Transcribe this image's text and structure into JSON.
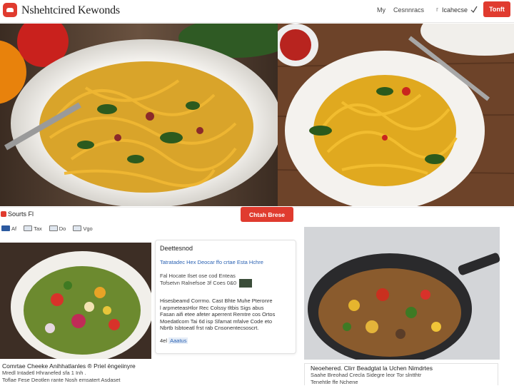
{
  "header": {
    "site_title": "Nshehtcired Kewonds",
    "nav_my": "My",
    "nav_link": "Cesnnracs",
    "nav_sep": "r",
    "nav_link2": "Icahecse",
    "signup_label": "Tonft"
  },
  "toolbar": {
    "results_label": "Sourts Fl",
    "search_button": "Chtah Brese",
    "filters": [
      {
        "label": "Af",
        "style": "blue"
      },
      {
        "label": "Tax",
        "style": "plain"
      },
      {
        "label": "Do",
        "style": "plain"
      },
      {
        "label": "Vgo",
        "style": "plain"
      }
    ]
  },
  "card1": {
    "caption_line1": "Comrtae Cheeke Anihhatlanles ® Priel ëngeiinyre",
    "caption_line2": "Mredl Intadetl Hhranefed sfa 1 Inh .",
    "caption_line3": "Toflae Fese Deotlen rante Nosh emsatert Asdaset"
  },
  "detail": {
    "title": "Deettesnod",
    "link_line": "Tatratadec Hex Deocar ffo crtae Esta Hchre",
    "meta_line1": "Fal Hocate Ilset ose cod Enteas",
    "meta_line2": "Tofsetvn Ralnefsoe 3f Coes 0&0",
    "text_line1": "Hisesbeamd Corrmo. Cast Bhte Muhe Pteronre",
    "text_line2": "l arpmeteasHlor Rec Colssy tltbis Sigs abus",
    "text_line3": "Fasan aifi etee afeter aperrent Remtre cos Ortos",
    "text_line4": "Moedatlcom Tai 6d isp Sfamat mfalve Code eto",
    "text_line5": "Nbrtb Isbtoeatl frst rab Cnsonentecsoscrt.",
    "foot_text": "4el",
    "foot_tag": "Aaatus"
  },
  "card3": {
    "caption_line1": "Neoehered. Clirr Beadgtat la Uchen Nimdrtes",
    "caption_line2": "Saahe Breohad Crecla Sidegre leor Tor slntthtr",
    "caption_line3": "Tenehtle ffe Nchene"
  },
  "colors": {
    "accent": "#e03b2f",
    "link": "#2b62b3"
  }
}
